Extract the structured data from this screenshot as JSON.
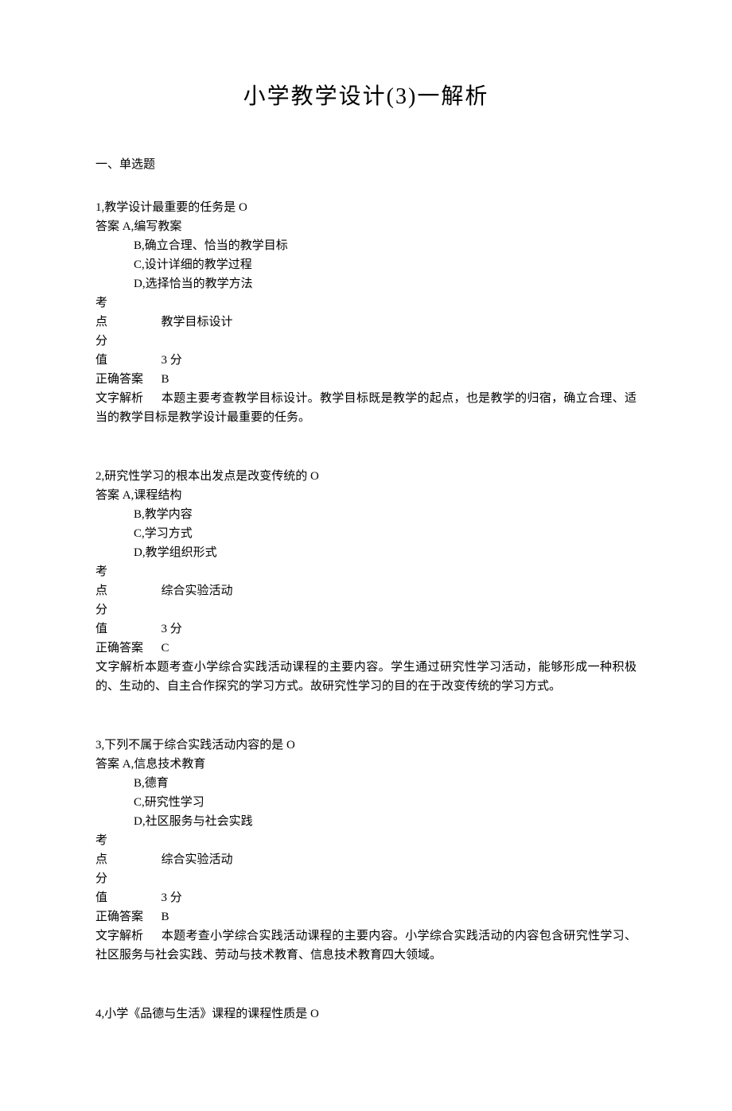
{
  "title": "小学教学设计(3)一解析",
  "section_header": "一、单选题",
  "questions": [
    {
      "num": "1,",
      "stem": "教学设计最重要的任务是 O",
      "answer_prefix": "答案 A,",
      "option_a": "编写教案",
      "option_b": "B,确立合理、恰当的教学目标",
      "option_c": "C,设计详细的教学过程",
      "option_d": "D,选择恰当的教学方法",
      "exam_point_label": "考点",
      "exam_point": "教学目标设计",
      "score_label": "分值",
      "score": "3 分",
      "correct_label": "正确答案",
      "correct": "B",
      "explain_label": "文字解析",
      "explain": "本题主要考查教学目标设计。教学目标既是教学的起点，也是教学的归宿，确立合理、适当的教学目标是教学设计最重要的任务。"
    },
    {
      "num": "2,",
      "stem": "研究性学习的根本出发点是改变传统的 O",
      "answer_prefix": "答案 A,",
      "option_a": "课程结构",
      "option_b": "B,教学内容",
      "option_c": "C,学习方式",
      "option_d": "D,教学组织形式",
      "exam_point_label": "考点",
      "exam_point": "综合实验活动",
      "score_label": "分值",
      "score": "3 分",
      "correct_label": "正确答案",
      "correct": "C",
      "explain_label": "文字解析",
      "explain_inline": "本题考查小学综合实践活动课程的主要内容。学生通过研究性学习活动，能够形成一种积极的、生动的、自主合作探究的学习方式。故研究性学习的目的在于改变传统的学习方式。"
    },
    {
      "num": "3,",
      "stem": "下列不属于综合实践活动内容的是 O",
      "answer_prefix": "答案 A,",
      "option_a": "信息技术教育",
      "option_b": "B,德育",
      "option_c": "C,研究性学习",
      "option_d": "D,社区服务与社会实践",
      "exam_point_label": "考点",
      "exam_point": "综合实验活动",
      "score_label": "分值",
      "score": "3 分",
      "correct_label": "正确答案",
      "correct": "B",
      "explain_label": "文字解析",
      "explain": "本题考查小学综合实践活动课程的主要内容。小学综合实践活动的内容包含研究性学习、社区服务与社会实践、劳动与技术教育、信息技术教育四大领域。"
    },
    {
      "num": "4,",
      "stem": "小学《品德与生活》课程的课程性质是 O"
    }
  ]
}
